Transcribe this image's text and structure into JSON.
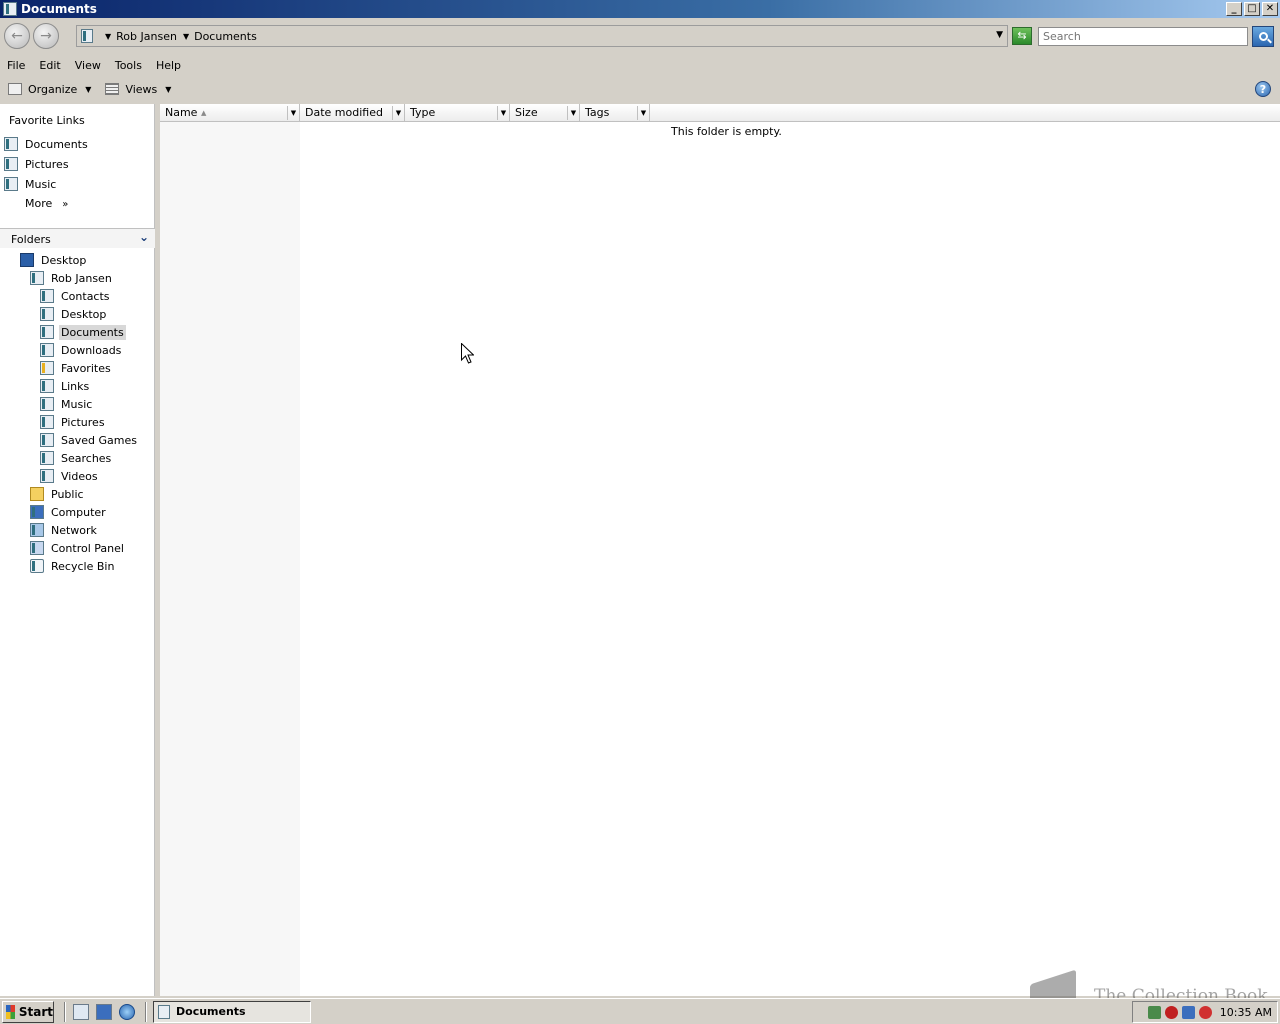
{
  "window": {
    "title": "Documents",
    "controls": {
      "minimize": "_",
      "maximize": "□",
      "close": "✕"
    }
  },
  "addressbar": {
    "back_icon": "back-arrow-icon",
    "forward_icon": "forward-arrow-icon",
    "crumbs": [
      "Rob Jansen",
      "Documents"
    ],
    "search_placeholder": "Search"
  },
  "menubar": {
    "items": [
      "File",
      "Edit",
      "View",
      "Tools",
      "Help"
    ]
  },
  "cmdbar": {
    "organize_label": "Organize",
    "views_label": "Views",
    "help_label": "?"
  },
  "navpane": {
    "favorites_title": "Favorite Links",
    "favorites": [
      "Documents",
      "Pictures",
      "Music"
    ],
    "more_label": "More",
    "folders_title": "Folders",
    "tree": [
      {
        "label": "Desktop",
        "level": 0
      },
      {
        "label": "Rob Jansen",
        "level": 1
      },
      {
        "label": "Contacts",
        "level": 2
      },
      {
        "label": "Desktop",
        "level": 2
      },
      {
        "label": "Documents",
        "level": 2,
        "selected": true
      },
      {
        "label": "Downloads",
        "level": 2
      },
      {
        "label": "Favorites",
        "level": 2
      },
      {
        "label": "Links",
        "level": 2
      },
      {
        "label": "Music",
        "level": 2
      },
      {
        "label": "Pictures",
        "level": 2
      },
      {
        "label": "Saved Games",
        "level": 2
      },
      {
        "label": "Searches",
        "level": 2
      },
      {
        "label": "Videos",
        "level": 2
      },
      {
        "label": "Public",
        "level": 1
      },
      {
        "label": "Computer",
        "level": 1
      },
      {
        "label": "Network",
        "level": 1
      },
      {
        "label": "Control Panel",
        "level": 1
      },
      {
        "label": "Recycle Bin",
        "level": 1
      }
    ]
  },
  "content": {
    "columns": [
      "Name",
      "Date modified",
      "Type",
      "Size",
      "Tags"
    ],
    "empty_message": "This folder is empty."
  },
  "taskbar": {
    "start_label": "Start",
    "task_label": "Documents",
    "clock": "10:35 AM"
  },
  "watermark": {
    "text": "The Collection Book"
  },
  "colors": {
    "titlebar_start": "#0a246a",
    "titlebar_end": "#a6caf0",
    "window_bg": "#d4d0c8",
    "selection": "#d8d8d8"
  }
}
